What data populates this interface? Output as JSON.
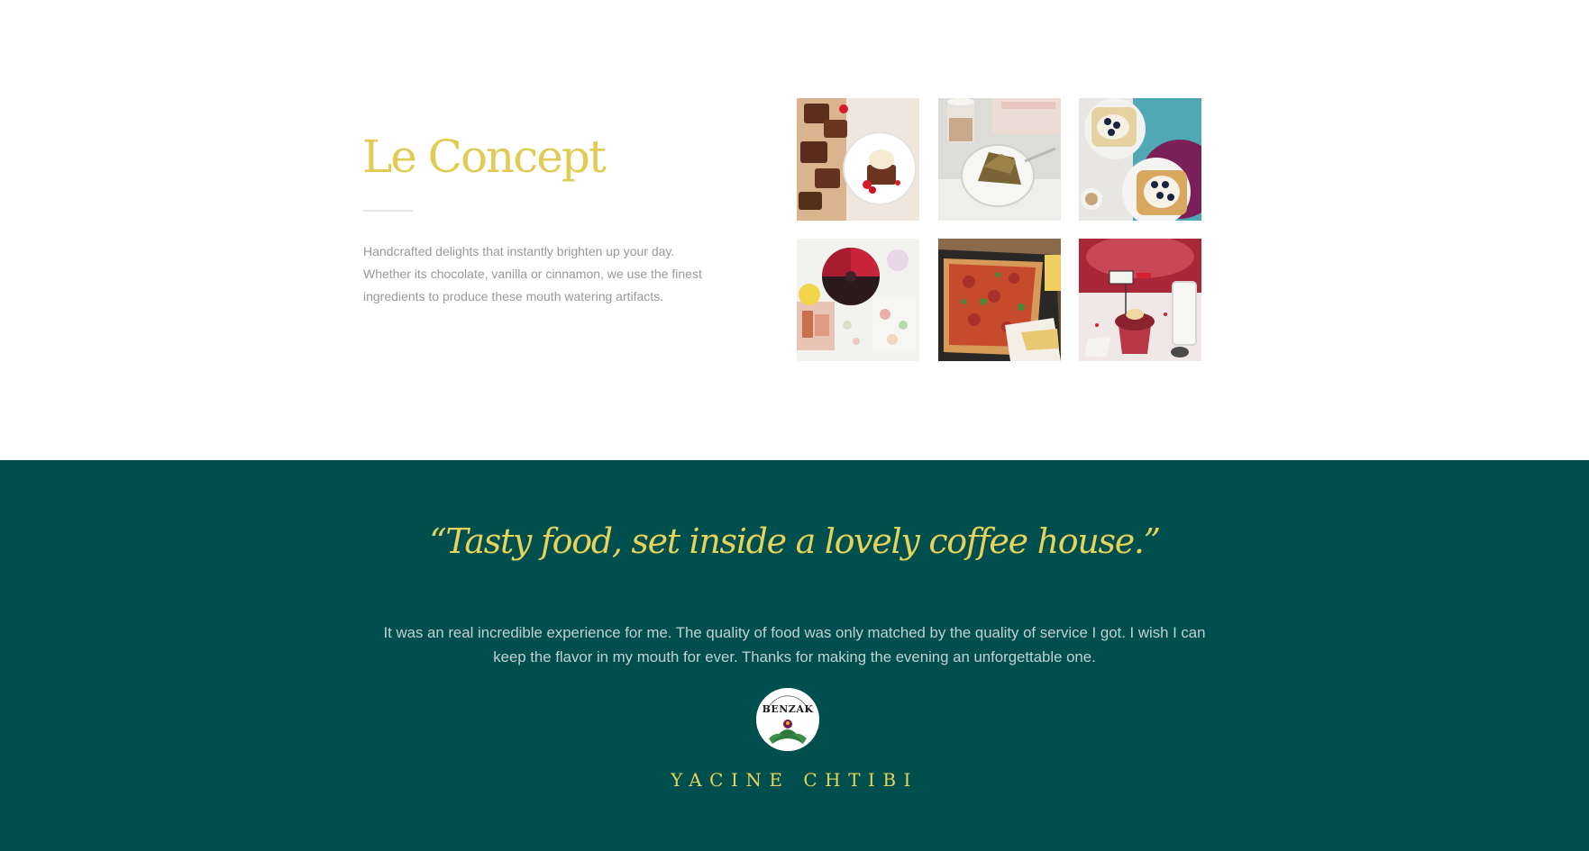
{
  "concept": {
    "title": "Le Concept",
    "description": "Handcrafted delights that instantly brighten up your day. Whether its chocolate, vanilla or cinnamon, we use the finest ingredients to produce these mouth watering artifacts.",
    "gallery": [
      {
        "subject": "brownies with ice cream and raspberries"
      },
      {
        "subject": "latte with cake slice on books"
      },
      {
        "subject": "toast with blueberries and coffee"
      },
      {
        "subject": "chocolate cake with fruit platter"
      },
      {
        "subject": "pizza slices on tray"
      },
      {
        "subject": "cupcake with flag and glass"
      }
    ]
  },
  "testimonial": {
    "quote": "“Tasty food, set inside a lovely coffee house.”",
    "review": "It was an real incredible experience for me. The quality of food was only matched by the quality of service I got. I wish I can keep the flavor in my mouth for ever. Thanks for making the evening an unforgettable one.",
    "avatar_logo_text": "BENZAK",
    "author": "YACINE CHTIBI"
  },
  "colors": {
    "accent_gold": "#e0cc55",
    "teal_background": "#004f4f",
    "body_text": "#999999",
    "review_text": "#c2d0d0"
  }
}
